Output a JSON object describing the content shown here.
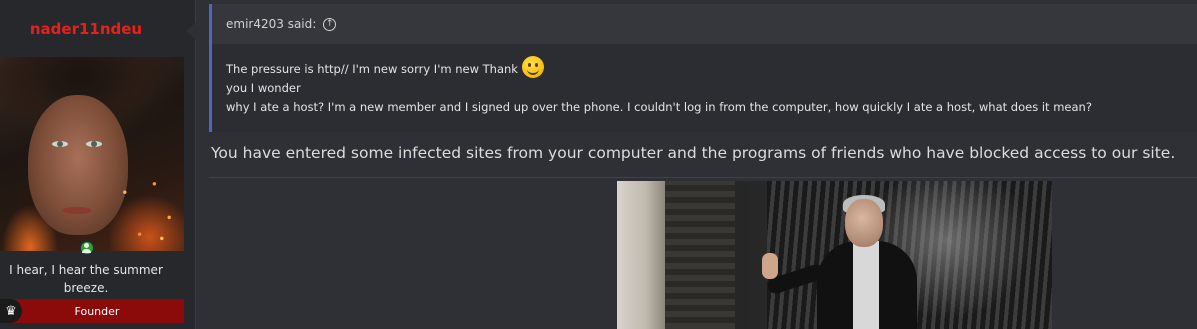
{
  "user": {
    "username": "nader11ndeu",
    "title_line1": "I hear, I hear the summer",
    "title_line2": "breeze.",
    "rank": "Founder",
    "username_color": "#e8201c",
    "rank_color": "#8b0a0a",
    "online_icon": "online-user-icon",
    "rank_icon": "crown-icon"
  },
  "quote": {
    "author_said": "emir4203 said:",
    "jump_icon": "arrow-up-circle-icon",
    "line1": "The pressure is http// I'm new sorry I'm new Thank",
    "smiley_icon": "smiley-icon",
    "line2": "you I wonder",
    "line3": "why I ate a host? I'm a new member and I signed up over the phone. I couldn't log in from the computer, how quickly I ate a host, what does it mean?",
    "accent_color": "#4f65c8"
  },
  "reply": {
    "text": "You have entered some infected sites from your computer and the programs of friends who have blocked access to our site."
  }
}
